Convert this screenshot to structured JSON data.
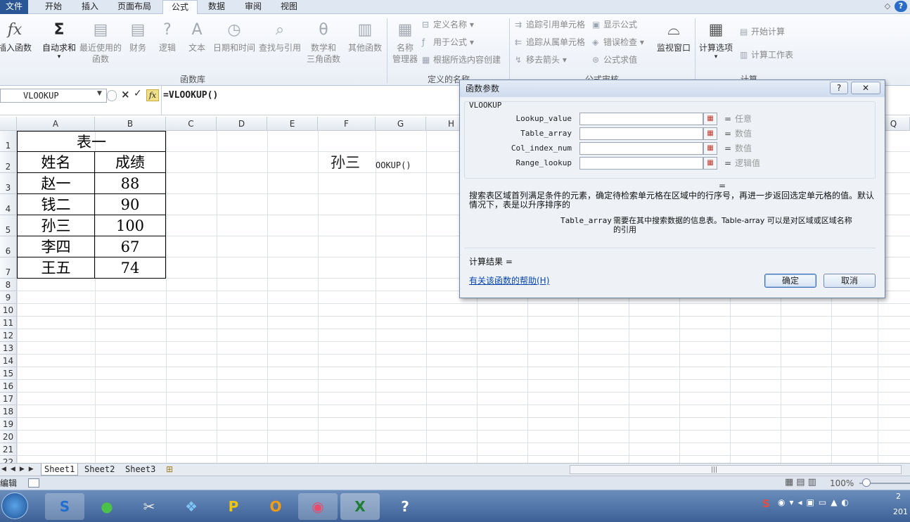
{
  "ribbon_tabs": [
    "文件",
    "开始",
    "插入",
    "页面布局",
    "公式",
    "数据",
    "审阅",
    "视图"
  ],
  "active_tab": "公式",
  "window_controls": [
    "◇",
    "?"
  ],
  "function_library": {
    "group_label": "函数库",
    "insert_function": "插入函数",
    "autosum": "自动求和",
    "recent_1": "最近使用的",
    "recent_2": "函数",
    "financial": "财务",
    "logical": "逻辑",
    "text": "文本",
    "datetime": "日期和时间",
    "lookup": "查找与引用",
    "math_1": "数学和",
    "math_2": "三角函数",
    "other": "其他函数"
  },
  "defined_names": {
    "group_label": "定义的名称",
    "name_manager_1": "名称",
    "name_manager_2": "管理器",
    "define_name": "定义名称",
    "use_in_formula": "用于公式",
    "create_from_selection": "根据所选内容创建"
  },
  "formula_auditing": {
    "group_label": "公式审核",
    "trace_precedents": "追踪引用单元格",
    "trace_dependents": "追踪从属单元格",
    "remove_arrows": "移去箭头",
    "show_formulas": "显示公式",
    "error_checking": "错误检查",
    "evaluate_formula": "公式求值",
    "watch_window": "监视窗口"
  },
  "calculation": {
    "group_label": "计算",
    "options": "计算选项",
    "calc_now": "开始计算",
    "calc_sheet": "计算工作表"
  },
  "formula_bar": {
    "name_box": "VLOOKUP",
    "formula": "=VLOOKUP()",
    "fx": "fx"
  },
  "columns": [
    "A",
    "B",
    "C",
    "D",
    "E",
    "F",
    "G",
    "H",
    "Q"
  ],
  "rows": [
    "1",
    "2",
    "3",
    "4",
    "5",
    "6",
    "7",
    "8",
    "9",
    "10",
    "11",
    "12",
    "13",
    "14",
    "15",
    "16",
    "17",
    "18",
    "19",
    "20",
    "21",
    "22"
  ],
  "table": {
    "title": "表一",
    "headers": [
      "姓名",
      "成绩"
    ],
    "rows": [
      [
        "赵一",
        "88"
      ],
      [
        "钱二",
        "90"
      ],
      [
        "孙三",
        "100"
      ],
      [
        "李四",
        "67"
      ],
      [
        "王五",
        "74"
      ]
    ]
  },
  "cells": {
    "f2": "孙三",
    "g2": "OOKUP()"
  },
  "sheet_tabs": [
    "Sheet1",
    "Sheet2",
    "Sheet3"
  ],
  "status": {
    "mode": "编辑",
    "zoom": "100%"
  },
  "taskbar_apps": [
    "sogou-input",
    "wechat",
    "scissors-tool",
    "cloud-sync",
    "pptv-player",
    "outlook",
    "video-recorder",
    "excel",
    "help"
  ],
  "tray": {
    "ime": "S",
    "year_fragment": "201",
    "day_fragment": "2"
  },
  "dialog": {
    "title": "函数参数",
    "help_btn": "?",
    "close_btn": "✕",
    "function_name": "VLOOKUP",
    "args": [
      {
        "label": "Lookup_value",
        "eq": "=",
        "value": "任意"
      },
      {
        "label": "Table_array",
        "eq": "=",
        "value": "数值"
      },
      {
        "label": "Col_index_num",
        "eq": "=",
        "value": "数值"
      },
      {
        "label": "Range_lookup",
        "eq": "=",
        "value": "逻辑值"
      }
    ],
    "result_eq": "=",
    "description_1": "搜索表区域首列满足条件的元素，确定待检索单元格在区域中的行序号，再进一步返回选定单元格的值。默认",
    "description_2": "情况下，表是以升序排序的",
    "arg_name": "Table_array",
    "arg_desc_1": "需要在其中搜索数据的信息表。Table-array 可以是对区域或区域名称",
    "arg_desc_2": "的引用",
    "calc_result": "计算结果 =",
    "help_link": "有关该函数的帮助(H)",
    "ok": "确定",
    "cancel": "取消"
  }
}
